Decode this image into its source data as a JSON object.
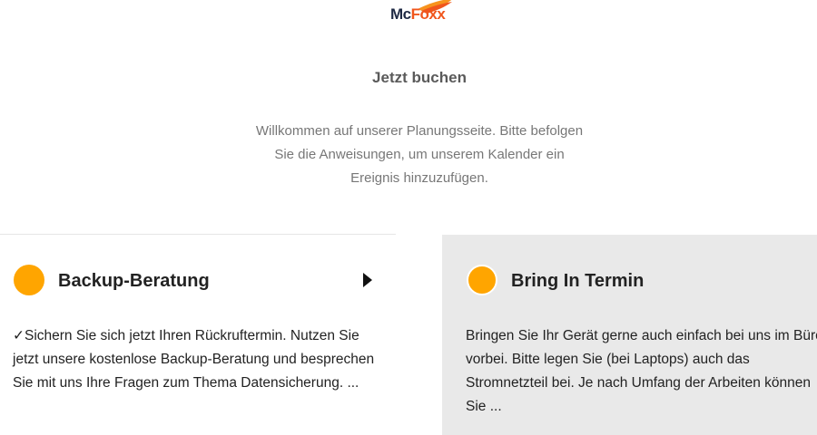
{
  "brand": {
    "logo_mc": "Mc",
    "logo_foxx": "Foxx"
  },
  "header": {
    "title": "Jetzt buchen",
    "intro": "Willkommen auf unserer Planungsseite. Bitte befolgen Sie die Anweisungen, um unserem Kalender ein Ereignis hinzuzufügen."
  },
  "services": [
    {
      "title": "Backup-Beratung",
      "description": "✓Sichern Sie sich jetzt Ihren Rückruftermin. Nutzen Sie jetzt unsere kostenlose Backup-Beratung und besprechen Sie mit uns Ihre Fragen zum Thema Datensicherung. ...",
      "icon": "orange-circle-icon",
      "arrow_icon": "play-arrow-icon"
    },
    {
      "title": "Bring In Termin",
      "description": "Bringen Sie Ihr Gerät gerne auch einfach bei uns im Büro vorbei. Bitte legen Sie (bei Laptops) auch das Stromnetzteil bei. Je nach Umfang der Arbeiten können Sie ...",
      "icon": "orange-circle-icon"
    }
  ],
  "colors": {
    "accent": "#ffa500",
    "brand_orange": "#f0561d",
    "brand_navy": "#1f2a44",
    "selected_card_bg": "#e9e9e9"
  }
}
